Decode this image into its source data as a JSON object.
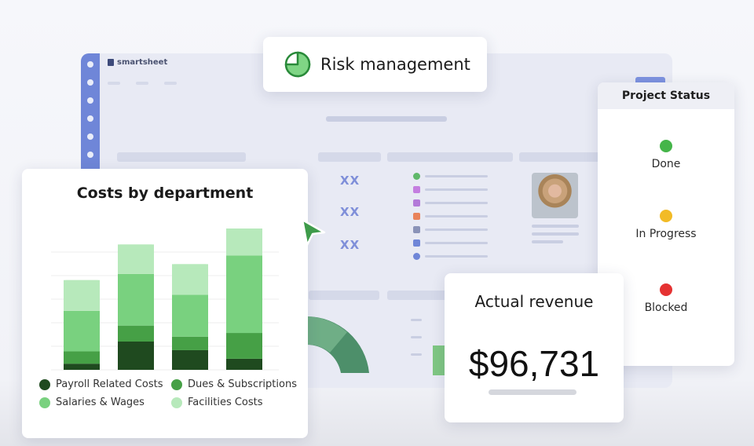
{
  "app": {
    "brand": "smartsheet"
  },
  "background": {
    "placeholder_text": [
      "XX",
      "XX",
      "XX"
    ]
  },
  "risk_card": {
    "title": "Risk management",
    "icon": "pie-chart-icon"
  },
  "costs_card": {
    "title": "Costs by department",
    "legend": [
      {
        "label": "Payroll Related Costs",
        "color": "#1f4a1f"
      },
      {
        "label": "Dues & Subscriptions",
        "color": "#46a046"
      },
      {
        "label": "Salaries & Wages",
        "color": "#79d17f"
      },
      {
        "label": "Facilities Costs",
        "color": "#b7e9bb"
      }
    ]
  },
  "chart_data": {
    "type": "bar",
    "stacked": true,
    "title": "Costs by department",
    "categories": [
      "",
      "",
      "",
      ""
    ],
    "series": [
      {
        "name": "Payroll Related Costs",
        "color": "#1f4a1f",
        "values": [
          5,
          23,
          16,
          9
        ]
      },
      {
        "name": "Dues & Subscriptions",
        "color": "#46a046",
        "values": [
          10,
          13,
          11,
          21
        ]
      },
      {
        "name": "Salaries & Wages",
        "color": "#79d17f",
        "values": [
          33,
          42,
          34,
          63
        ]
      },
      {
        "name": "Facilities Costs",
        "color": "#b7e9bb",
        "values": [
          25,
          24,
          25,
          22
        ]
      }
    ],
    "ylim": [
      0,
      115
    ],
    "grid": true,
    "legend": "bottom"
  },
  "status_card": {
    "title": "Project Status",
    "items": [
      {
        "label": "Done",
        "color": "#45b549"
      },
      {
        "label": "In Progress",
        "color": "#f2bb26"
      },
      {
        "label": "Blocked",
        "color": "#e53232"
      }
    ]
  },
  "revenue_card": {
    "title": "Actual revenue",
    "value": "$96,731"
  },
  "colors": {
    "accent_green": "#3e9b4a",
    "rail_blue": "#6f86d8"
  }
}
